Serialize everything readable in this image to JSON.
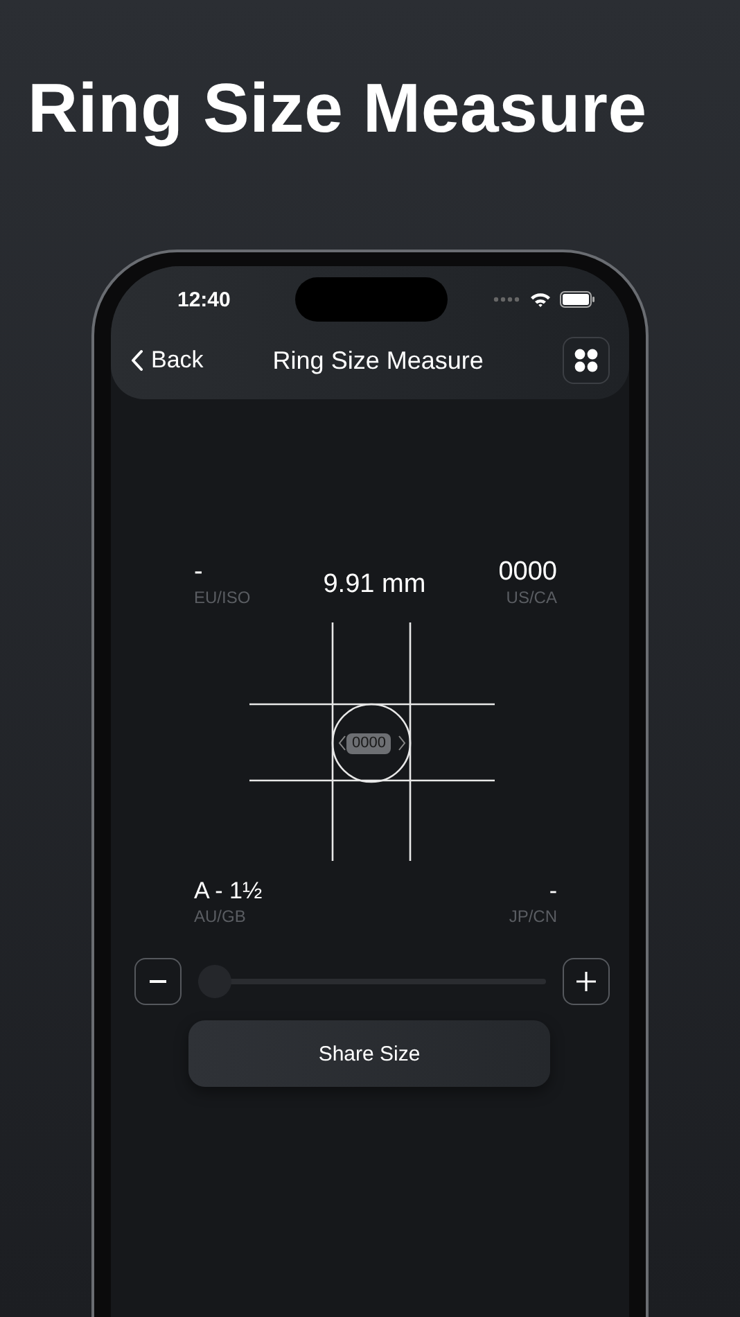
{
  "headline": "Ring Size Measure",
  "status_bar": {
    "time": "12:40"
  },
  "nav": {
    "back": "Back",
    "title": "Ring Size Measure"
  },
  "top_sizes": [
    {
      "value": "-",
      "system": "EU/ISO"
    },
    {
      "value": "0000",
      "system": "US/CA"
    }
  ],
  "diameter": "9.91 mm",
  "gauge": {
    "badge": "0000"
  },
  "bottom_sizes": [
    {
      "value": "A - 1½",
      "system": "AU/GB"
    },
    {
      "value": "-",
      "system": "JP/CN"
    }
  ],
  "slider": {
    "level": 0
  },
  "share_button": "Share Size"
}
